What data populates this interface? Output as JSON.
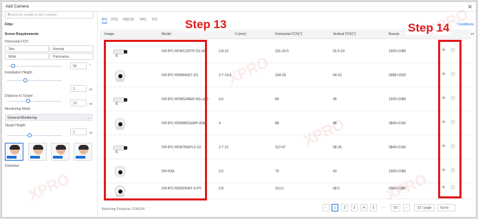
{
  "dialog": {
    "title": "Add Camera",
    "close_icon": "close-icon"
  },
  "left": {
    "search_placeholder": "Search by model or part number",
    "filter_label": "Filter",
    "conditions_link": "Conditions",
    "scene_label": "Scene Requirements",
    "reset_link": "Reset",
    "horizontal_fov_label": "Horizontal FOV",
    "fov_options": [
      "Tele",
      "Normal",
      "Wide",
      "Panorama"
    ],
    "fov_value": "55",
    "fov_unit": "°",
    "installation_height_label": "Installation Height",
    "installation_height_value": "3",
    "distance_label": "Distance to Target",
    "distance_value": "10",
    "monitoring_mode_label": "Monitoring Mode",
    "monitoring_mode_value": "General Monitoring",
    "target_height_label": "Target Height",
    "target_height_value": "2",
    "unit_m": "m",
    "detection_label": "Detection"
  },
  "tabs": [
    "IPC",
    "PTZ",
    "HDCVI",
    "TPC",
    "ITC"
  ],
  "table": {
    "columns": [
      "Image",
      "Model",
      "h (mm)",
      "Horizontal FOV(°)",
      "Vertical FOV(°)",
      "Resolu"
    ],
    "rows": [
      {
        "image": "bullet-camera",
        "model": "DH-IPC-HFW1230TP-ZS-S5",
        "focal": "2.8-12",
        "hfov": "101-33.5",
        "vfov": "52.5-19",
        "res": "1920×1080"
      },
      {
        "image": "dome-camera",
        "model": "DH-IPC-HDW4441T-ZS",
        "focal": "2.7-13.5",
        "hfov": "104-29",
        "vfov": "54-16",
        "res": "2688×1520"
      },
      {
        "image": "bullet-camera",
        "model": "DH-IPC-HFW5249EP-AS-LED",
        "focal": "3.6",
        "hfov": "84",
        "vfov": "45",
        "res": "1920×1080"
      },
      {
        "image": "turret-camera",
        "model": "DH-IPC-HDW4831EMP-ASE",
        "focal": "4",
        "hfov": "88",
        "vfov": "48",
        "res": "3840×2160"
      },
      {
        "image": "bullet-camera",
        "model": "DH-IPC-HFW7842H-Z-S2",
        "focal": "2.7-12",
        "hfov": "112-47",
        "vfov": "58-26",
        "res": "3840×2160"
      },
      {
        "image": "cube-camera",
        "model": "DH-H2A",
        "focal": "3.6",
        "hfov": "79",
        "vfov": "43",
        "res": "1920×1080"
      },
      {
        "image": "dome-camera",
        "model": "DH-IPC-HDW2549T-S-PV",
        "focal": "2.8",
        "hfov": "110.0",
        "vfov": "58.5",
        "res": "2960×1880"
      }
    ],
    "add_icon": "plus-icon",
    "favorite_icon": "star-icon"
  },
  "annotations": {
    "step13": "Step 13",
    "step14": "Step 14",
    "highlight_color": "#e11919"
  },
  "footer": {
    "matching": "Matching Products: 624/624",
    "pages": [
      "1",
      "2",
      "3",
      "4",
      "5",
      "···",
      "53"
    ],
    "page_size": "10 / page",
    "goto": "Go to"
  },
  "watermark": "XPRO"
}
